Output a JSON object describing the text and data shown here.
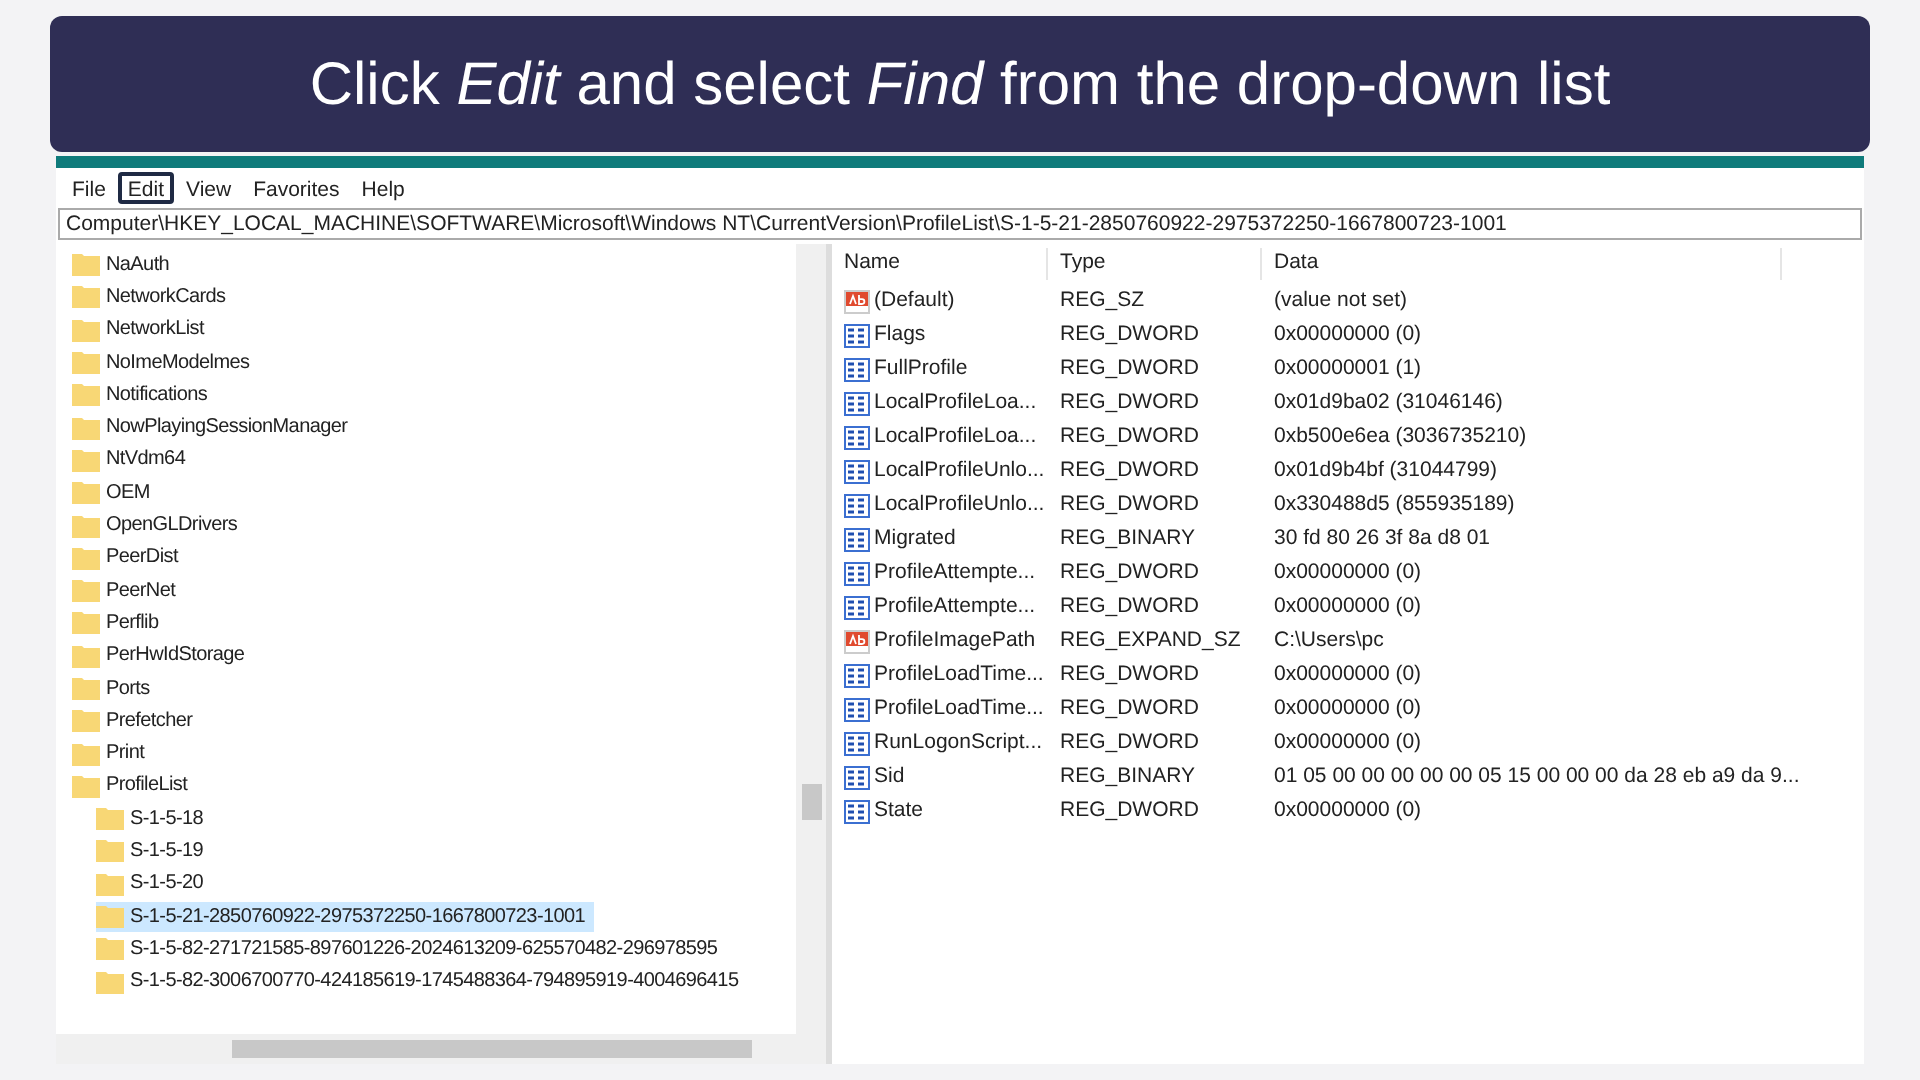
{
  "banner": {
    "text": "Click *Edit* and select *Find* from the drop-down list"
  },
  "menu": [
    {
      "label": "File",
      "selected": false
    },
    {
      "label": "Edit",
      "selected": true
    },
    {
      "label": "View",
      "selected": false
    },
    {
      "label": "Favorites",
      "selected": false
    },
    {
      "label": "Help",
      "selected": false
    }
  ],
  "address": "Computer\\HKEY_LOCAL_MACHINE\\SOFTWARE\\Microsoft\\Windows NT\\CurrentVersion\\ProfileList\\S-1-5-21-2850760922-2975372250-1667800723-1001",
  "tree": [
    {
      "label": "NaAuth",
      "selected": false
    },
    {
      "label": "NetworkCards",
      "selected": false
    },
    {
      "label": "NetworkList",
      "selected": false
    },
    {
      "label": "NoImeModelmes",
      "selected": false
    },
    {
      "label": "Notifications",
      "selected": false
    },
    {
      "label": "NowPlayingSessionManager",
      "selected": false
    },
    {
      "label": "NtVdm64",
      "selected": false
    },
    {
      "label": "OEM",
      "selected": false
    },
    {
      "label": "OpenGLDrivers",
      "selected": false
    },
    {
      "label": "PeerDist",
      "selected": false
    },
    {
      "label": "PeerNet",
      "selected": false
    },
    {
      "label": "Perflib",
      "selected": false
    },
    {
      "label": "PerHwIdStorage",
      "selected": false
    },
    {
      "label": "Ports",
      "selected": false
    },
    {
      "label": "Prefetcher",
      "selected": false
    },
    {
      "label": "Print",
      "selected": false
    },
    {
      "label": "ProfileList",
      "selected": false,
      "children": [
        {
          "label": "S-1-5-18",
          "selected": false
        },
        {
          "label": "S-1-5-19",
          "selected": false
        },
        {
          "label": "S-1-5-20",
          "selected": false
        },
        {
          "label": "S-1-5-21-2850760922-2975372250-1667800723-1001",
          "selected": true
        },
        {
          "label": "S-1-5-82-271721585-897601226-2024613209-625570482-296978595",
          "selected": false
        },
        {
          "label": "S-1-5-82-3006700770-424185619-1745488364-794895919-4004696415",
          "selected": false
        }
      ]
    }
  ],
  "table": {
    "columns": [
      "Name",
      "Type",
      "Data"
    ],
    "rows": [
      {
        "kind": "string",
        "name": "(Default)",
        "type": "REG_SZ",
        "data": "(value not set)"
      },
      {
        "kind": "binary",
        "name": "Flags",
        "type": "REG_DWORD",
        "data": "0x00000000 (0)"
      },
      {
        "kind": "binary",
        "name": "FullProfile",
        "type": "REG_DWORD",
        "data": "0x00000001 (1)"
      },
      {
        "kind": "binary",
        "name": "LocalProfileLoa...",
        "type": "REG_DWORD",
        "data": "0x01d9ba02 (31046146)"
      },
      {
        "kind": "binary",
        "name": "LocalProfileLoa...",
        "type": "REG_DWORD",
        "data": "0xb500e6ea (3036735210)"
      },
      {
        "kind": "binary",
        "name": "LocalProfileUnlo...",
        "type": "REG_DWORD",
        "data": "0x01d9b4bf (31044799)"
      },
      {
        "kind": "binary",
        "name": "LocalProfileUnlo...",
        "type": "REG_DWORD",
        "data": "0x330488d5 (855935189)"
      },
      {
        "kind": "binary",
        "name": "Migrated",
        "type": "REG_BINARY",
        "data": "30 fd 80 26 3f 8a d8 01"
      },
      {
        "kind": "binary",
        "name": "ProfileAttempte...",
        "type": "REG_DWORD",
        "data": "0x00000000 (0)"
      },
      {
        "kind": "binary",
        "name": "ProfileAttempte...",
        "type": "REG_DWORD",
        "data": "0x00000000 (0)"
      },
      {
        "kind": "string",
        "name": "ProfileImagePath",
        "type": "REG_EXPAND_SZ",
        "data": "C:\\Users\\pc"
      },
      {
        "kind": "binary",
        "name": "ProfileLoadTime...",
        "type": "REG_DWORD",
        "data": "0x00000000 (0)"
      },
      {
        "kind": "binary",
        "name": "ProfileLoadTime...",
        "type": "REG_DWORD",
        "data": "0x00000000 (0)"
      },
      {
        "kind": "binary",
        "name": "RunLogonScript...",
        "type": "REG_DWORD",
        "data": "0x00000000 (0)"
      },
      {
        "kind": "binary",
        "name": "Sid",
        "type": "REG_BINARY",
        "data": "01 05 00 00 00 00 00 05 15 00 00 00 da 28 eb a9 da 9..."
      },
      {
        "kind": "binary",
        "name": "State",
        "type": "REG_DWORD",
        "data": "0x00000000 (0)"
      }
    ]
  }
}
